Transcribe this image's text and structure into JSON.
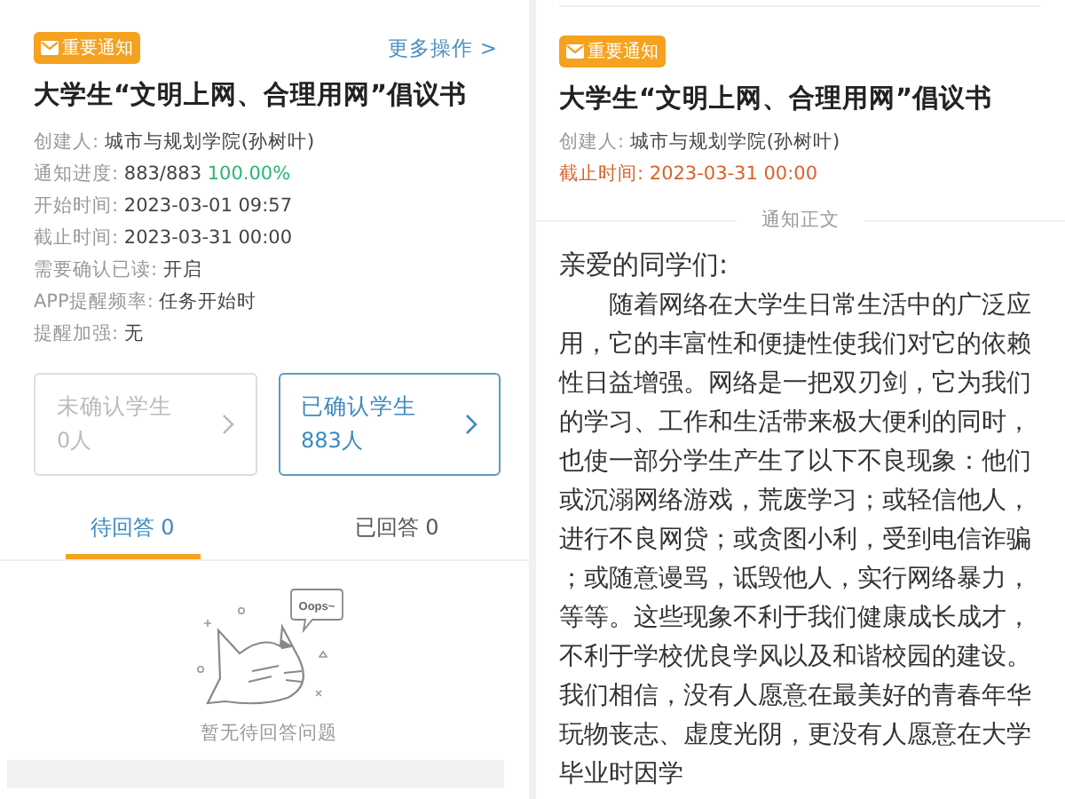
{
  "left": {
    "badge": "重要通知",
    "more": "更多操作 >",
    "title": "大学生“文明上网、合理用网”倡议书",
    "info": [
      {
        "label": "创建人:",
        "value": "城市与规划学院(孙树叶)",
        "kind": "plain"
      },
      {
        "label": "通知进度:",
        "value": "883/883",
        "highlight": "100.00%",
        "kind": "plain"
      },
      {
        "label": "开始时间:",
        "value": "2023-03-01 09:57",
        "kind": "plain"
      },
      {
        "label": "截止时间:",
        "value": "2023-03-31 00:00",
        "kind": "plain"
      },
      {
        "label": "需要确认已读:",
        "value": "开启",
        "kind": "plain"
      },
      {
        "label": "APP提醒频率:",
        "value": "任务开始时",
        "kind": "plain"
      },
      {
        "label": "提醒加强:",
        "value": "无",
        "kind": "plain"
      }
    ],
    "cards": [
      {
        "label": "未确认学生",
        "count": "0人",
        "selected": false
      },
      {
        "label": "已确认学生",
        "count": "883人",
        "selected": true
      }
    ],
    "tabs": [
      {
        "label": "待回答 0",
        "selected": true
      },
      {
        "label": "已回答 0",
        "selected": false
      }
    ],
    "empty": {
      "bubble": "Oops~",
      "message": "暂无待回答问题"
    }
  },
  "right": {
    "badge": "重要通知",
    "title": "大学生“文明上网、合理用网”倡议书",
    "info": [
      {
        "label": "创建人:",
        "value": "城市与规划学院(孙树叶)",
        "kind": "plain"
      },
      {
        "label": "截止时间:",
        "value": "2023-03-31 00:00",
        "kind": "alert"
      }
    ],
    "divider": "通知正文",
    "greeting": "亲爱的同学们:",
    "body": "随着网络在大学生日常生活中的广泛应用，它的丰富性和便捷性使我们对它的依赖性日益增强。网络是一把双刃剑，它为我们的学习、工作和生活带来极大便利的同时，也使一部分学生产生了以下不良现象：他们或沉溺网络游戏，荒废学习；或轻信他人，进行不良网贷；或贪图小利，受到电信诈骗；或随意谩骂，诋毁他人，实行网络暴力，等等。这些现象不利于我们健康成长成才，不利于学校优良学风以及和谐校园的建设。我们相信，没有人愿意在最美好的青春年华玩物丧志、虚度光阴，更没有人愿意在大学毕业时因学"
  }
}
